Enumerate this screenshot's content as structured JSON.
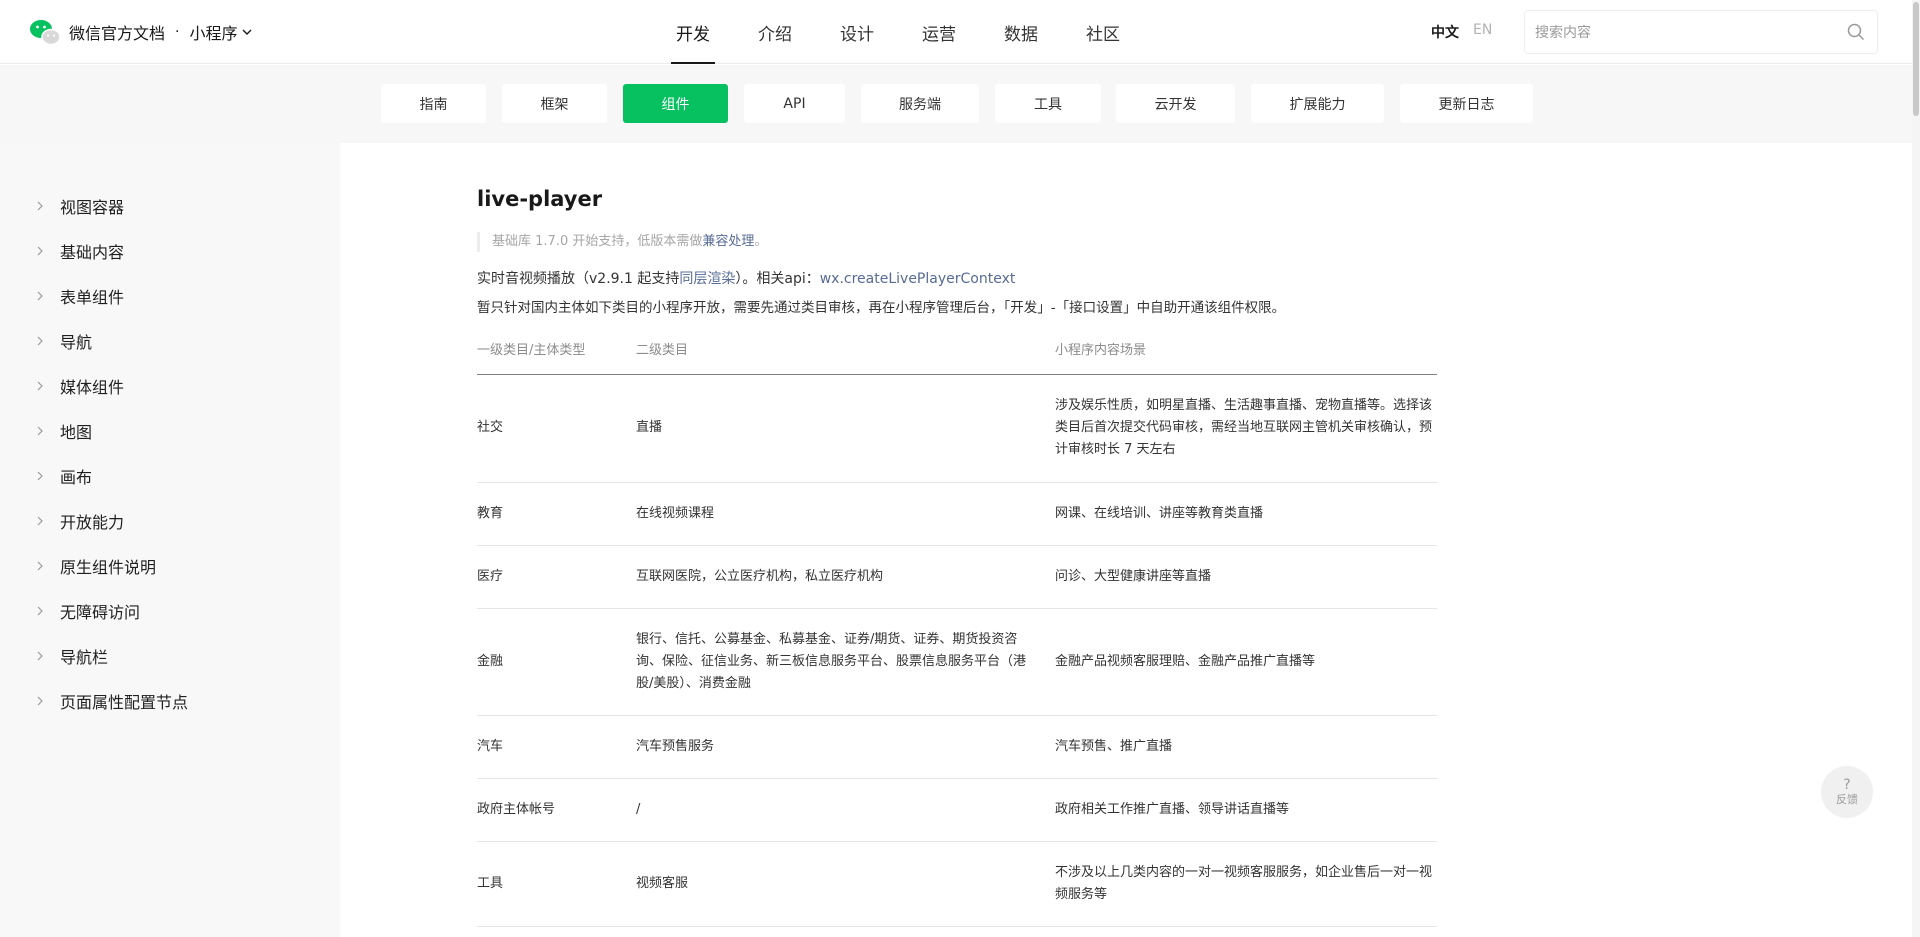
{
  "header": {
    "brand_title": "微信官方文档",
    "separator": "·",
    "product": "小程序",
    "nav": [
      "开发",
      "介绍",
      "设计",
      "运营",
      "数据",
      "社区"
    ],
    "active_nav": "开发",
    "lang_zh": "中文",
    "lang_en": "EN",
    "search_placeholder": "搜索内容"
  },
  "subnav": {
    "items": [
      "指南",
      "框架",
      "组件",
      "API",
      "服务端",
      "工具",
      "云开发",
      "扩展能力",
      "更新日志"
    ],
    "active": "组件"
  },
  "sidebar": {
    "items": [
      "视图容器",
      "基础内容",
      "表单组件",
      "导航",
      "媒体组件",
      "地图",
      "画布",
      "开放能力",
      "原生组件说明",
      "无障碍访问",
      "导航栏",
      "页面属性配置节点"
    ]
  },
  "content": {
    "title": "live-player",
    "notice_prefix": "基础库 1.7.0 开始支持，低版本需做",
    "notice_link": "兼容处理",
    "notice_suffix": "。",
    "desc1_prefix": "实时音视频播放（v2.9.1 起支持",
    "desc1_link1": "同层渲染",
    "desc1_middle": "）。相关api：",
    "desc1_link2": "wx.createLivePlayerContext",
    "desc2": "暂只针对国内主体如下类目的小程序开放，需要先通过类目审核，再在小程序管理后台，「开发」-「接口设置」中自助开通该组件权限。",
    "table": {
      "headers": [
        "一级类目/主体类型",
        "二级类目",
        "小程序内容场景"
      ],
      "rows": [
        [
          "社交",
          "直播",
          "涉及娱乐性质，如明星直播、生活趣事直播、宠物直播等。选择该类目后首次提交代码审核，需经当地互联网主管机关审核确认，预计审核时长 7 天左右"
        ],
        [
          "教育",
          "在线视频课程",
          "网课、在线培训、讲座等教育类直播"
        ],
        [
          "医疗",
          "互联网医院，公立医疗机构，私立医疗机构",
          "问诊、大型健康讲座等直播"
        ],
        [
          "金融",
          "银行、信托、公募基金、私募基金、证券/期货、证券、期货投资咨询、保险、征信业务、新三板信息服务平台、股票信息服务平台（港股/美股）、消费金融",
          "金融产品视频客服理赔、金融产品推广直播等"
        ],
        [
          "汽车",
          "汽车预售服务",
          "汽车预售、推广直播"
        ],
        [
          "政府主体帐号",
          "/",
          "政府相关工作推广直播、领导讲话直播等"
        ],
        [
          "工具",
          "视频客服",
          "不涉及以上几类内容的一对一视频客服服务，如企业售后一对一视频服务等"
        ]
      ]
    }
  },
  "feedback": {
    "icon": "?",
    "label": "反馈"
  },
  "colors": {
    "accent_green": "#07c160",
    "link_blue": "#576b95"
  }
}
